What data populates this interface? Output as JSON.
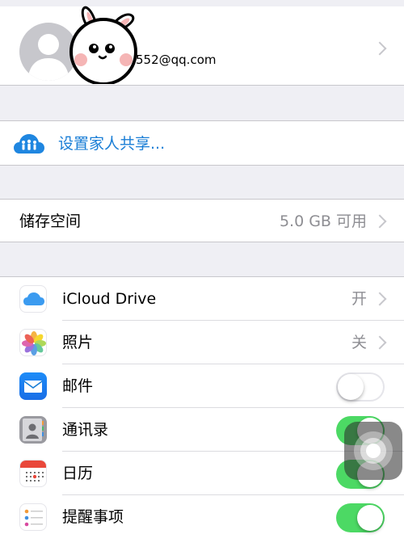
{
  "account": {
    "email": "552@qq.com"
  },
  "family_sharing": {
    "label": "设置家人共享..."
  },
  "storage": {
    "label": "储存空间",
    "value": "5.0 GB 可用"
  },
  "apps": [
    {
      "label": "iCloud Drive",
      "value": "开",
      "control": "chevron",
      "icon": "icloud-drive-icon"
    },
    {
      "label": "照片",
      "value": "关",
      "control": "chevron",
      "icon": "photos-icon"
    },
    {
      "label": "邮件",
      "control": "toggle",
      "state": "off",
      "icon": "mail-icon"
    },
    {
      "label": "通讯录",
      "control": "toggle",
      "state": "on",
      "icon": "contacts-icon"
    },
    {
      "label": "日历",
      "control": "toggle",
      "state": "on",
      "icon": "calendar-icon"
    },
    {
      "label": "提醒事项",
      "control": "toggle",
      "state": "on",
      "icon": "reminders-icon"
    }
  ],
  "colors": {
    "accent": "#1a7ed6",
    "toggle_on": "#4cd964",
    "background": "#efeff4"
  }
}
